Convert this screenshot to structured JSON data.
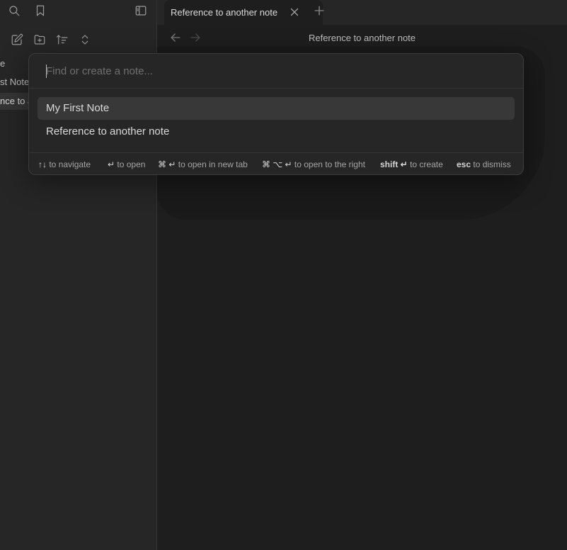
{
  "sidebar": {
    "files": [
      {
        "label": "e",
        "active": false
      },
      {
        "label": "st Note",
        "active": false
      },
      {
        "label": "nce to a",
        "active": true
      }
    ]
  },
  "tabs": [
    {
      "label": "Reference to another note",
      "active": true
    }
  ],
  "view": {
    "title": "Reference to another note"
  },
  "switcher": {
    "placeholder": "Find or create a note...",
    "value": "",
    "suggestions": [
      {
        "label": "My First Note",
        "selected": true
      },
      {
        "label": "Reference to another note",
        "selected": false
      }
    ],
    "instructions": [
      {
        "keys": "↑↓",
        "text": "to navigate"
      },
      {
        "keys": "↵",
        "text": "to open"
      },
      {
        "keys": "⌘ ↵",
        "text": "to open in new tab"
      },
      {
        "keys": "⌘ ⌥ ↵",
        "text": "to open to the right"
      },
      {
        "keys": "shift ↵",
        "text": "to create"
      },
      {
        "keys": "esc",
        "text": "to dismiss"
      }
    ]
  },
  "icons": [
    "search-icon",
    "bookmark-icon",
    "sidebar-toggle-icon",
    "new-note-icon",
    "new-folder-icon",
    "sort-icon",
    "collapse-expand-icon",
    "close-icon",
    "plus-icon",
    "arrow-left-icon",
    "arrow-right-icon"
  ]
}
